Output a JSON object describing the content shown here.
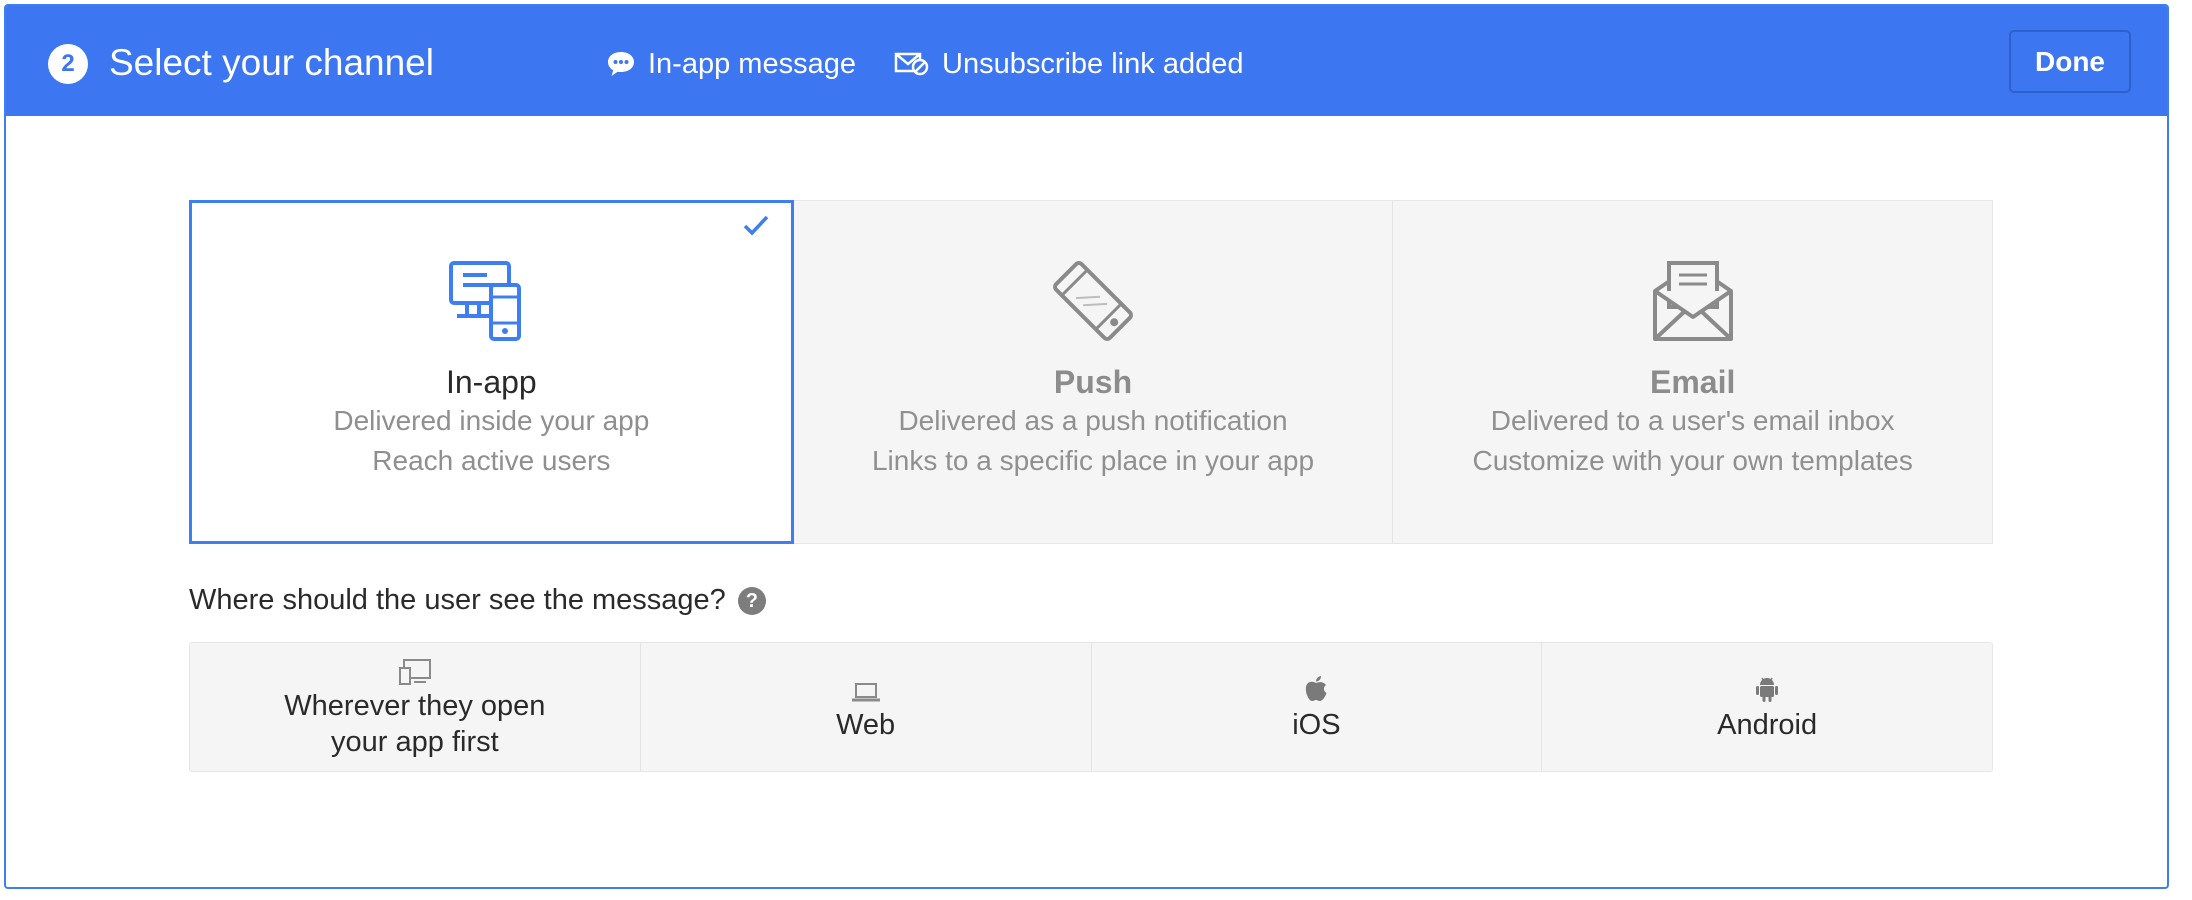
{
  "header": {
    "step_number": "2",
    "title": "Select your channel",
    "items": [
      {
        "icon": "chat-bubble-icon",
        "label": "In-app message"
      },
      {
        "icon": "unsubscribe-mail-icon",
        "label": "Unsubscribe link added"
      }
    ],
    "done_label": "Done"
  },
  "channels": [
    {
      "name": "In-app",
      "desc1": "Delivered inside your app",
      "desc2": "Reach active users",
      "selected": true,
      "icon": "devices-icon"
    },
    {
      "name": "Push",
      "desc1": "Delivered as a push notification",
      "desc2": "Links to a specific place in your app",
      "selected": false,
      "icon": "phone-tilted-icon"
    },
    {
      "name": "Email",
      "desc1": "Delivered to a user's email inbox",
      "desc2": "Customize with your own templates",
      "selected": false,
      "icon": "envelope-icon"
    }
  ],
  "placement": {
    "question": "Where should the user see the message?",
    "help_glyph": "?",
    "options": [
      {
        "line1": "Wherever they open",
        "line2": "your app first",
        "icon": "multi-device-icon"
      },
      {
        "label": "Web",
        "icon": "laptop-icon"
      },
      {
        "label": "iOS",
        "icon": "apple-icon"
      },
      {
        "label": "Android",
        "icon": "android-icon"
      }
    ]
  },
  "colors": {
    "accent": "#3c76f0",
    "selected_border": "#3d7ff0",
    "muted_text": "#8c8c8c",
    "card_bg": "#f5f5f5"
  }
}
